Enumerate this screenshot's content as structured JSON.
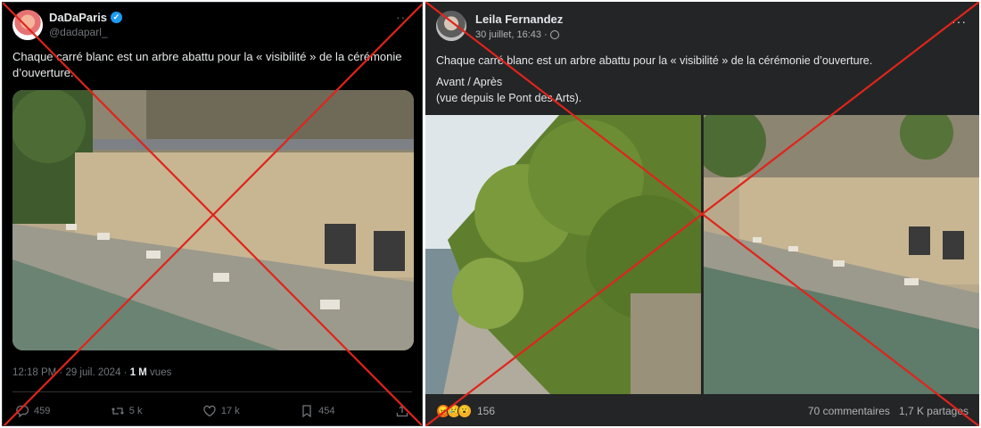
{
  "left_post": {
    "display_name": "DaDaParis",
    "handle": "@dadaparl_",
    "more": "···",
    "text": "Chaque carré blanc est un arbre abattu pour la « visibilité » de la cérémonie d’ouverture.",
    "timestamp": "12:18 PM · 29 juil. 2024 · ",
    "views_count": "1 M",
    "views_label": " vues",
    "actions": {
      "replies": "459",
      "reposts": "5 k",
      "likes": "17 k",
      "bookmarks": "454"
    }
  },
  "right_post": {
    "display_name": "Leila Fernandez",
    "date": "30 juillet, 16:43 ·",
    "more": "···",
    "text_line1": "Chaque carré blanc est un arbre abattu pour la « visibilité » de la cérémonie d’ouverture.",
    "text_line2": "Avant / Après",
    "text_line3": "(vue depuis le Pont des Arts).",
    "reaction_count": "156",
    "comments": "70 commentaires",
    "shares": "1,7 K partages"
  },
  "colors": {
    "cross": "#e0241b",
    "x_background": "#000000",
    "fb_background": "#242526",
    "verified": "#1d9bf0"
  }
}
